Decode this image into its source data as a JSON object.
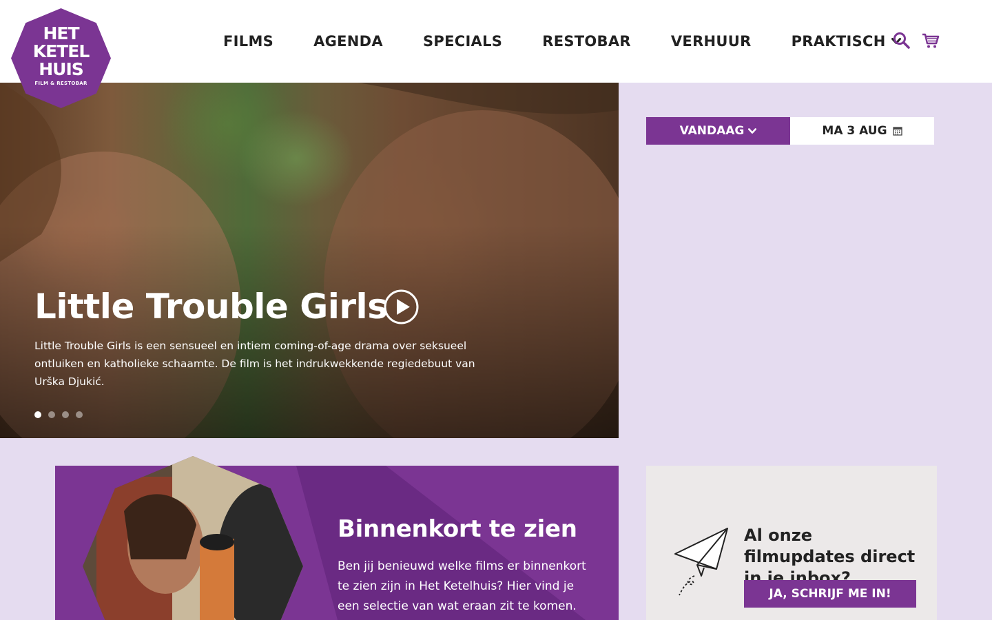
{
  "colors": {
    "brand_purple": "#7b3593",
    "page_background": "#e5dcf0",
    "newsletter_background": "#ece9e9",
    "text_dark": "#222222"
  },
  "logo": {
    "line1": "HET",
    "line2": "KETEL",
    "line3": "HUIS",
    "subline": "FILM & RESTOBAR"
  },
  "nav": {
    "items": [
      {
        "label": "FILMS"
      },
      {
        "label": "AGENDA"
      },
      {
        "label": "SPECIALS"
      },
      {
        "label": "RESTOBAR"
      },
      {
        "label": "VERHUUR"
      },
      {
        "label": "PRAKTISCH",
        "icon": "chevron-down-icon"
      }
    ],
    "icons": [
      "search-icon",
      "cart-icon"
    ]
  },
  "hero": {
    "title": "Little Trouble Girls",
    "description": "Little Trouble Girls is een sensueel en intiem coming-of-age drama over seksueel ontluiken en katholieke schaamte. De film is het indrukwekkende regiedebuut van Urška Djukić.",
    "play_icon": "play-icon",
    "slides_total": 4,
    "active_slide": 1
  },
  "day_selector": {
    "today_label": "VANDAAG",
    "today_icon": "chevron-down-icon",
    "date_label": "MA 3 AUG",
    "date_icon": "calendar-icon"
  },
  "promo": {
    "title": "Binnenkort te zien",
    "text": "Ben jij benieuwd welke films er binnenkort te zien zijn in Het Ketelhuis? Hier vind je een selectie van wat eraan zit te komen."
  },
  "newsletter": {
    "icon": "paper-plane-icon",
    "title": "Al onze filmupdates direct in je inbox?",
    "button_label": "JA, SCHRIJF ME IN!"
  }
}
